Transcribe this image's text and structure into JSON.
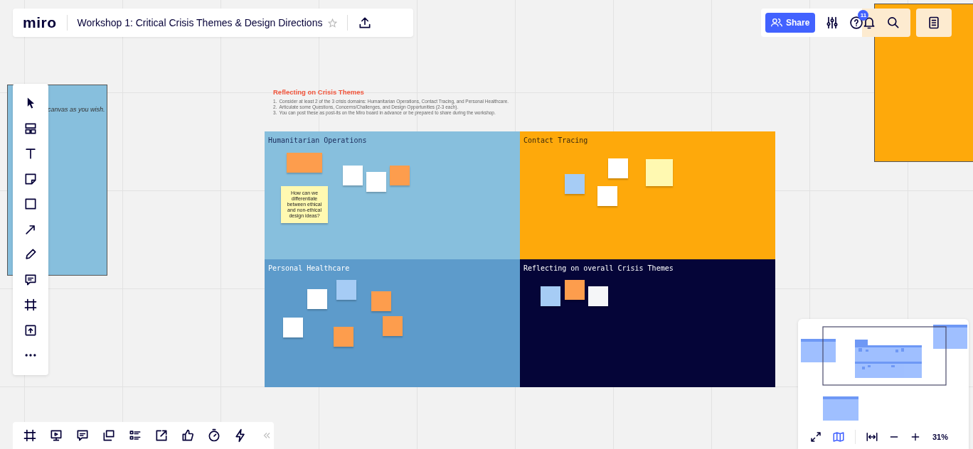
{
  "board": {
    "logo": "miro",
    "title": "Workshop 1: Critical Crisis Themes & Design Directions",
    "starred": false
  },
  "header_actions": {
    "share": "Share",
    "help_badge": "11"
  },
  "canvas": {
    "side_frame_text": "canvas as you wish.",
    "instructions": {
      "title": "Reflecting on Crisis Themes",
      "steps": [
        {
          "marker": "1.",
          "text": "Consider at least 2 of the 3 crisis domains: Humanitarian Operations, Contact Tracing, and Personal Healthcare."
        },
        {
          "marker": "2.",
          "text": "Articulate some Questions, Concerns/Challenges, and Design Opportunities (2-3 each)."
        },
        {
          "marker": "3.",
          "text": "You can post these as post-its on the Miro board in advance or be prepared to share during the workshop."
        }
      ]
    },
    "frames": [
      {
        "title": "Humanitarian Operations",
        "color": "#87bfdd",
        "notes": [
          {
            "color": "#fd9d4d"
          },
          {
            "color": "#fff9b1",
            "text": "How can we differentiate between ethical and non-ethical design ideas?"
          },
          {
            "color": "#ffffff"
          },
          {
            "color": "#ffffff"
          },
          {
            "color": "#fd9d4d"
          }
        ]
      },
      {
        "title": "Contact Tracing",
        "color": "#fea90b",
        "notes": [
          {
            "color": "#a6ccf5"
          },
          {
            "color": "#ffffff"
          },
          {
            "color": "#ffffff"
          },
          {
            "color": "#fff9b1"
          }
        ]
      },
      {
        "title": "Personal Healthcare",
        "color": "#5d9bcb",
        "notes": [
          {
            "color": "#ffffff"
          },
          {
            "color": "#a6ccf5"
          },
          {
            "color": "#fd9d4d"
          },
          {
            "color": "#fd9d4d"
          },
          {
            "color": "#ffffff"
          },
          {
            "color": "#fd9d4d"
          }
        ]
      },
      {
        "title": "Reflecting on overall Crisis Themes",
        "color": "#050538",
        "notes": [
          {
            "color": "#a6ccf5"
          },
          {
            "color": "#fd9d4d"
          },
          {
            "color": "#f5f6f8"
          }
        ]
      }
    ]
  },
  "zoom": {
    "level_text": "31%"
  }
}
